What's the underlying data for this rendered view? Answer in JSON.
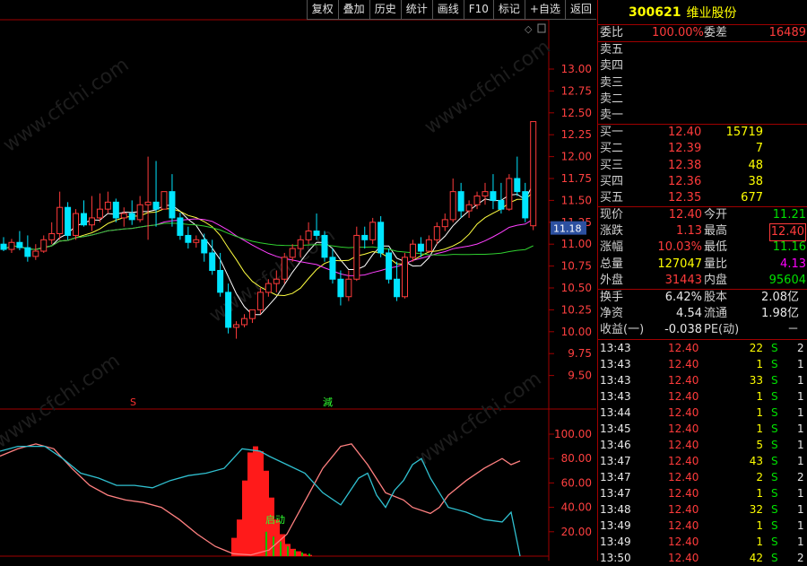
{
  "toolbar": [
    "复权",
    "叠加",
    "历史",
    "统计",
    "画线",
    "F10",
    "标记",
    "+自选",
    "返回"
  ],
  "stock": {
    "code": "300621",
    "name": "维业股份"
  },
  "price_axis": [
    "13.00",
    "12.75",
    "12.50",
    "12.25",
    "12.00",
    "11.75",
    "11.50",
    "11.25",
    "11.00",
    "10.75",
    "10.50",
    "10.25",
    "10.00",
    "9.75",
    "9.50"
  ],
  "current_price_tag": "11.18",
  "indicator_axis": [
    "100.00",
    "80.00",
    "60.00",
    "40.00",
    "20.00"
  ],
  "markers": {
    "s": "S",
    "jian": "減",
    "qidong": "启动"
  },
  "watermark": "www.cfchi.com",
  "quote": {
    "weibi_label": "委比",
    "weibi": "100.00%",
    "weicha_label": "委差",
    "weicha": "16489",
    "asks": [
      {
        "label": "卖五",
        "price": "",
        "vol": ""
      },
      {
        "label": "卖四",
        "price": "",
        "vol": ""
      },
      {
        "label": "卖三",
        "price": "",
        "vol": ""
      },
      {
        "label": "卖二",
        "price": "",
        "vol": ""
      },
      {
        "label": "卖一",
        "price": "",
        "vol": ""
      }
    ],
    "bids": [
      {
        "label": "买一",
        "price": "12.40",
        "vol": "15719"
      },
      {
        "label": "买二",
        "price": "12.39",
        "vol": "7"
      },
      {
        "label": "买三",
        "price": "12.38",
        "vol": "48"
      },
      {
        "label": "买四",
        "price": "12.36",
        "vol": "38"
      },
      {
        "label": "买五",
        "price": "12.35",
        "vol": "677"
      }
    ],
    "stats": [
      {
        "l1": "现价",
        "v1": "12.40",
        "l2": "今开",
        "v2": "11.21"
      },
      {
        "l1": "涨跌",
        "v1": "1.13",
        "l2": "最高",
        "v2": "12.40"
      },
      {
        "l1": "涨幅",
        "v1": "10.03%",
        "l2": "最低",
        "v2": "11.16"
      },
      {
        "l1": "总量",
        "v1": "127047",
        "l2": "量比",
        "v2": "4.13"
      },
      {
        "l1": "外盘",
        "v1": "31443",
        "l2": "内盘",
        "v2": "95604"
      }
    ],
    "fund": [
      {
        "l1": "换手",
        "v1": "6.42%",
        "l2": "股本",
        "v2": "2.08亿"
      },
      {
        "l1": "净资",
        "v1": "4.54",
        "l2": "流通",
        "v2": "1.98亿"
      },
      {
        "l1": "收益(一)",
        "v1": "-0.038",
        "l2": "PE(动)",
        "v2": "－"
      }
    ]
  },
  "ticks": [
    {
      "t": "13:43",
      "p": "12.40",
      "v": "22",
      "s": "S",
      "n": "2"
    },
    {
      "t": "13:43",
      "p": "12.40",
      "v": "1",
      "s": "S",
      "n": "1"
    },
    {
      "t": "13:43",
      "p": "12.40",
      "v": "33",
      "s": "S",
      "n": "1"
    },
    {
      "t": "13:43",
      "p": "12.40",
      "v": "1",
      "s": "S",
      "n": "1"
    },
    {
      "t": "13:44",
      "p": "12.40",
      "v": "1",
      "s": "S",
      "n": "1"
    },
    {
      "t": "13:45",
      "p": "12.40",
      "v": "1",
      "s": "S",
      "n": "1"
    },
    {
      "t": "13:46",
      "p": "12.40",
      "v": "5",
      "s": "S",
      "n": "1"
    },
    {
      "t": "13:47",
      "p": "12.40",
      "v": "43",
      "s": "S",
      "n": "1"
    },
    {
      "t": "13:47",
      "p": "12.40",
      "v": "2",
      "s": "S",
      "n": "2"
    },
    {
      "t": "13:47",
      "p": "12.40",
      "v": "1",
      "s": "S",
      "n": "1"
    },
    {
      "t": "13:48",
      "p": "12.40",
      "v": "32",
      "s": "S",
      "n": "1"
    },
    {
      "t": "13:49",
      "p": "12.40",
      "v": "1",
      "s": "S",
      "n": "1"
    },
    {
      "t": "13:49",
      "p": "12.40",
      "v": "1",
      "s": "S",
      "n": "1"
    },
    {
      "t": "13:50",
      "p": "12.40",
      "v": "42",
      "s": "S",
      "n": "2"
    }
  ],
  "candles": [
    [
      11.0,
      11.08,
      10.94,
      10.92
    ],
    [
      10.94,
      11.06,
      11.02,
      10.9
    ],
    [
      11.02,
      11.15,
      10.96,
      10.93
    ],
    [
      10.96,
      11.1,
      10.86,
      10.8
    ],
    [
      10.86,
      11.0,
      10.92,
      10.82
    ],
    [
      10.92,
      11.1,
      11.05,
      10.9
    ],
    [
      11.05,
      11.25,
      11.12,
      11.0
    ],
    [
      11.12,
      11.6,
      11.42,
      11.05
    ],
    [
      11.42,
      11.48,
      11.1,
      11.05
    ],
    [
      11.1,
      11.4,
      11.35,
      11.05
    ],
    [
      11.35,
      11.5,
      11.22,
      11.2
    ],
    [
      11.22,
      11.55,
      11.3,
      11.15
    ],
    [
      11.3,
      11.58,
      11.4,
      11.25
    ],
    [
      11.4,
      11.6,
      11.48,
      11.35
    ],
    [
      11.48,
      11.52,
      11.3,
      11.25
    ],
    [
      11.3,
      11.42,
      11.35,
      11.2
    ],
    [
      11.35,
      11.5,
      11.28,
      11.22
    ],
    [
      11.28,
      11.55,
      11.45,
      11.25
    ],
    [
      11.45,
      12.0,
      11.48,
      11.05
    ],
    [
      11.48,
      11.95,
      11.4,
      11.2
    ],
    [
      11.4,
      11.55,
      11.6,
      11.4
    ],
    [
      11.6,
      11.8,
      11.3,
      11.2
    ],
    [
      11.3,
      11.36,
      11.1,
      11.05
    ],
    [
      11.1,
      11.2,
      11.02,
      10.95
    ],
    [
      11.02,
      11.1,
      11.05,
      10.96
    ],
    [
      11.05,
      11.12,
      10.9,
      10.8
    ],
    [
      10.9,
      11.05,
      10.7,
      10.65
    ],
    [
      10.7,
      10.9,
      10.45,
      10.4
    ],
    [
      10.45,
      10.55,
      10.05,
      9.98
    ],
    [
      10.05,
      10.12,
      10.08,
      9.92
    ],
    [
      10.08,
      10.2,
      10.15,
      10.05
    ],
    [
      10.15,
      10.25,
      10.25,
      10.1
    ],
    [
      10.25,
      10.5,
      10.45,
      10.2
    ],
    [
      10.45,
      10.6,
      10.55,
      10.4
    ],
    [
      10.55,
      10.7,
      10.6,
      10.45
    ],
    [
      10.6,
      10.9,
      10.85,
      10.55
    ],
    [
      10.85,
      11.0,
      10.95,
      10.8
    ],
    [
      10.95,
      11.1,
      11.05,
      10.85
    ],
    [
      11.05,
      11.25,
      11.15,
      11.0
    ],
    [
      11.15,
      11.35,
      11.1,
      11.05
    ],
    [
      11.1,
      11.15,
      10.85,
      10.8
    ],
    [
      10.85,
      10.95,
      10.6,
      10.55
    ],
    [
      10.6,
      10.7,
      10.4,
      10.3
    ],
    [
      10.4,
      10.7,
      10.6,
      10.35
    ],
    [
      10.6,
      11.2,
      11.1,
      10.58
    ],
    [
      11.1,
      11.2,
      11.05,
      10.95
    ],
    [
      11.05,
      11.3,
      11.25,
      11.0
    ],
    [
      11.25,
      11.32,
      10.9,
      10.85
    ],
    [
      10.9,
      10.95,
      10.6,
      10.55
    ],
    [
      10.6,
      10.8,
      10.4,
      10.35
    ],
    [
      10.4,
      10.9,
      10.85,
      10.38
    ],
    [
      10.85,
      11.05,
      11.0,
      10.8
    ],
    [
      11.0,
      11.08,
      10.92,
      10.85
    ],
    [
      10.92,
      11.1,
      11.05,
      10.9
    ],
    [
      11.05,
      11.25,
      11.2,
      11.0
    ],
    [
      11.2,
      11.35,
      11.28,
      11.15
    ],
    [
      11.28,
      11.75,
      11.6,
      11.25
    ],
    [
      11.6,
      11.7,
      11.38,
      11.3
    ],
    [
      11.38,
      11.5,
      11.45,
      11.3
    ],
    [
      11.45,
      11.6,
      11.55,
      11.4
    ],
    [
      11.55,
      11.7,
      11.6,
      11.45
    ],
    [
      11.6,
      11.8,
      11.5,
      11.4
    ],
    [
      11.5,
      11.7,
      11.4,
      11.35
    ],
    [
      11.4,
      11.8,
      11.75,
      11.38
    ],
    [
      11.75,
      12.0,
      11.6,
      11.55
    ],
    [
      11.6,
      11.7,
      11.3,
      11.25
    ],
    [
      11.21,
      12.4,
      12.4,
      11.16
    ]
  ]
}
